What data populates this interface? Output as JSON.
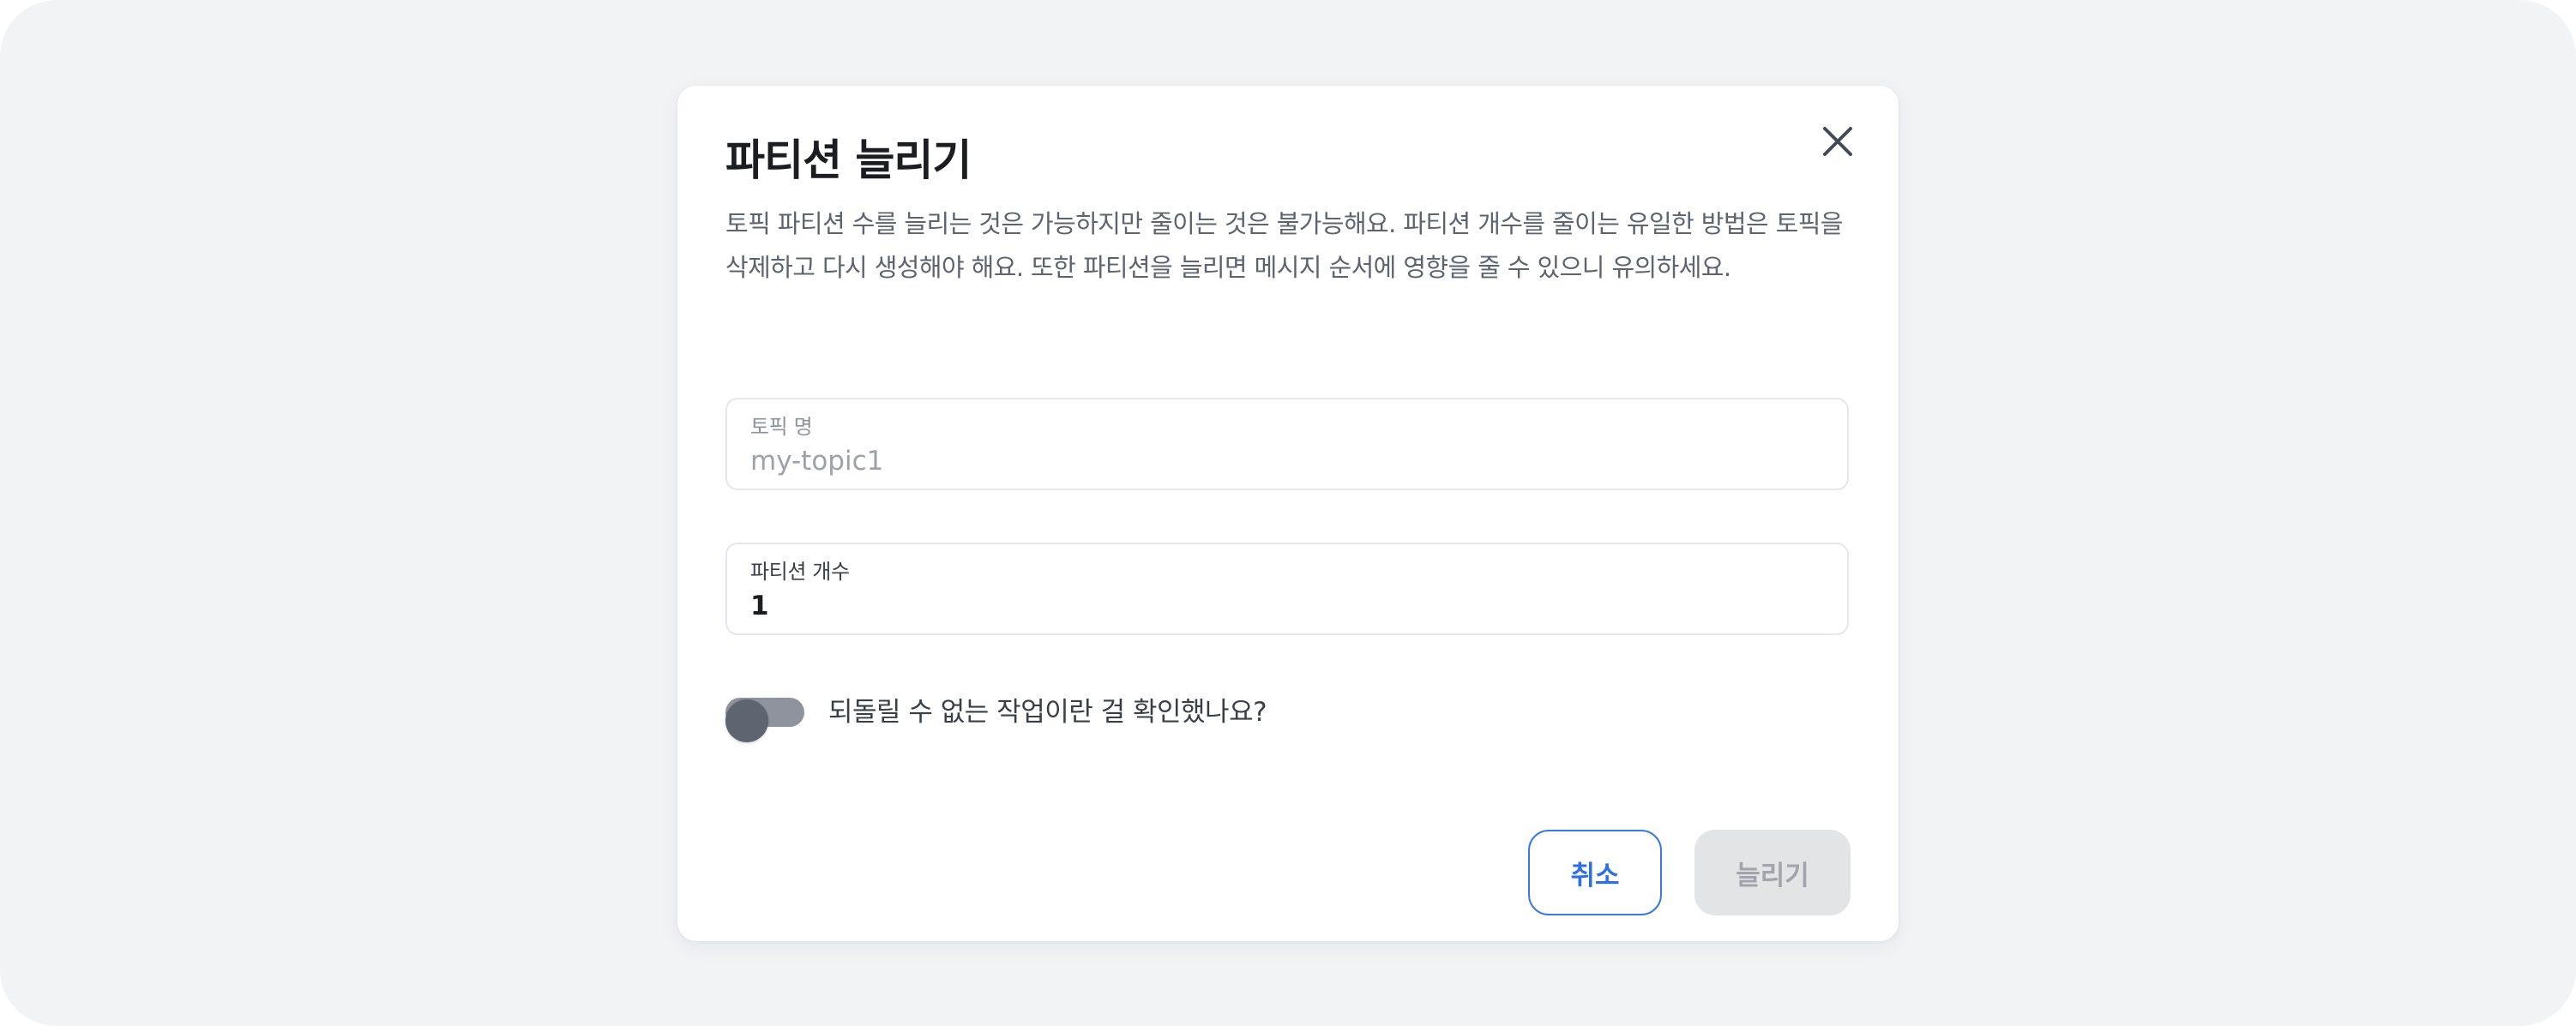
{
  "dialog": {
    "title": "파티션 늘리기",
    "description": "토픽 파티션 수를 늘리는 것은 가능하지만 줄이는 것은 불가능해요. 파티션 개수를 줄이는 유일한 방법은 토픽을 삭제하고 다시 생성해야 해요. 또한 파티션을 늘리면 메시지 순서에 영향을 줄 수 있으니 유의하세요.",
    "close_icon": "close-icon"
  },
  "fields": {
    "topic_name": {
      "label": "토픽 명",
      "value": "my-topic1",
      "disabled": true
    },
    "partition_count": {
      "label": "파티션 개수",
      "value": "1"
    }
  },
  "confirm_toggle": {
    "label": "되돌릴 수 없는 작업이란 걸 확인했나요?",
    "checked": false
  },
  "buttons": {
    "cancel_label": "취소",
    "confirm_label": "늘리기",
    "confirm_disabled": true
  },
  "colors": {
    "background": "#f2f3f5",
    "dialog": "#ffffff",
    "accent": "#2f6fe4",
    "disabled_button": "#e3e4e6"
  }
}
